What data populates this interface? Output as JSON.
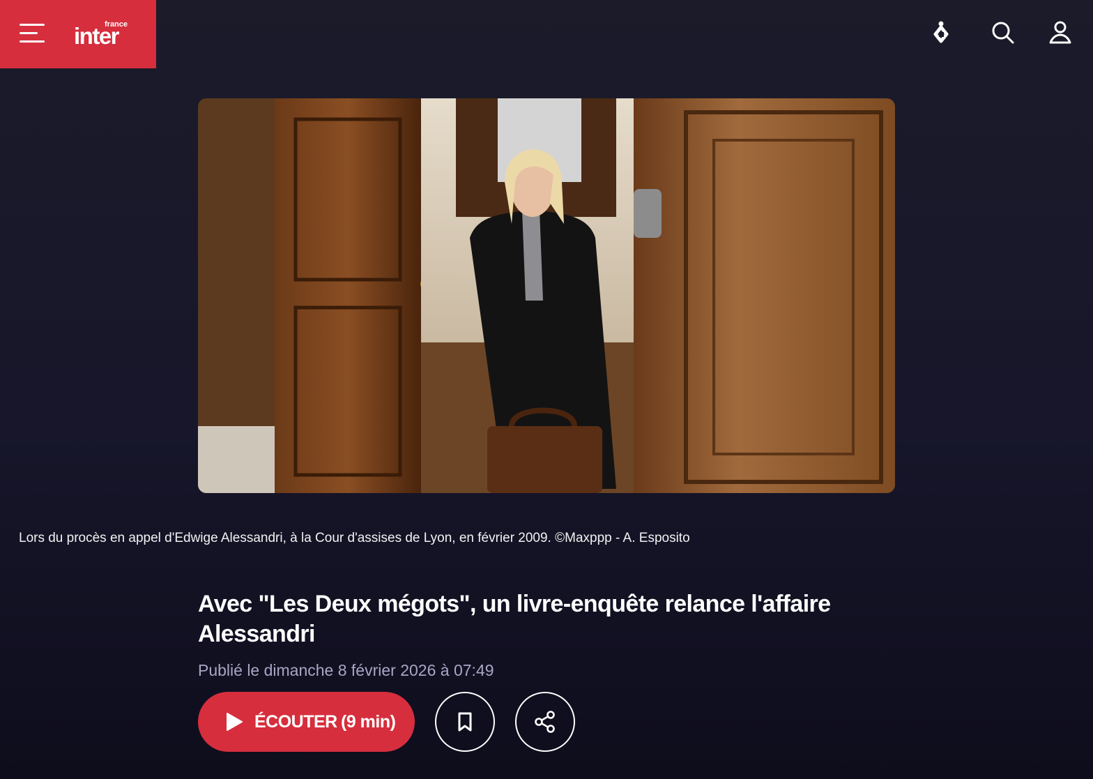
{
  "header": {
    "logo_small": "france",
    "logo_main": "inter",
    "menu_icon": "hamburger-menu-icon",
    "live_icon": "live-radio-icon",
    "search_icon": "search-icon",
    "account_icon": "user-account-icon"
  },
  "hero": {
    "caption": "Lors du procès en appel d'Edwige Alessandri, à la Cour d'assises de Lyon, en février 2009. ©Maxppp - A. Esposito"
  },
  "article": {
    "title": "Avec \"Les Deux mégots\", un livre-enquête relance l'affaire Alessandri",
    "published": "Publié le dimanche 8 février 2026 à 07:49"
  },
  "actions": {
    "listen_label": "ÉCOUTER",
    "listen_duration": "(9 min)",
    "play_icon": "play-icon",
    "bookmark_icon": "bookmark-icon",
    "share_icon": "share-icon"
  },
  "colors": {
    "brand_red": "#d62e3d",
    "background": "#1a1a28",
    "date_text": "#a9a6c6"
  }
}
